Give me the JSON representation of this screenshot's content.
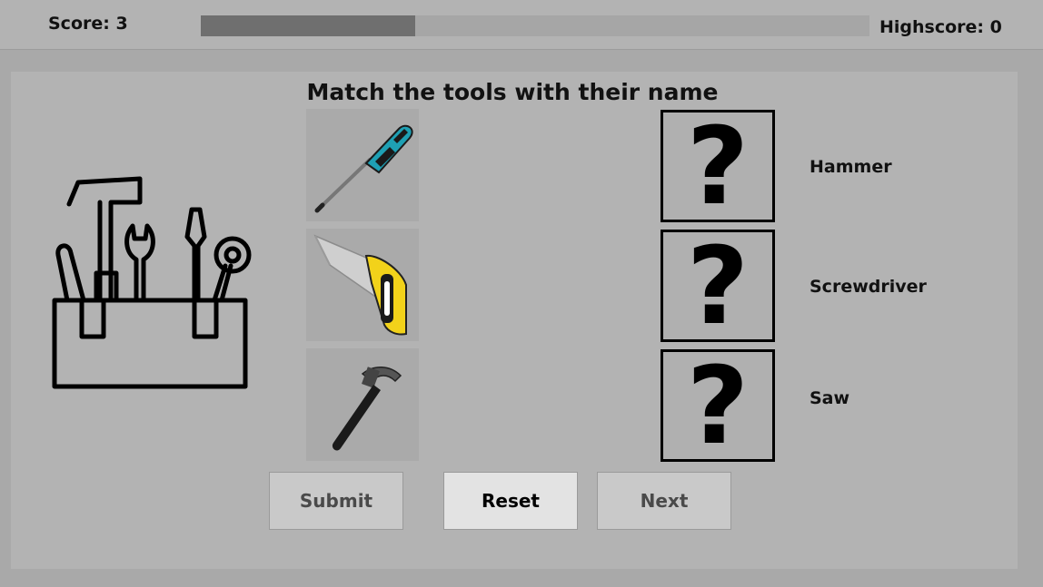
{
  "header": {
    "score_label": "Score: 3",
    "highscore_label": "Highscore: 0",
    "progress_fraction": 0.32
  },
  "game": {
    "title": "Match the tools with their name",
    "tools": [
      {
        "icon": "screwdriver-image"
      },
      {
        "icon": "saw-image"
      },
      {
        "icon": "hammer-image"
      }
    ],
    "slots": [
      "?",
      "?",
      "?"
    ],
    "names": [
      "Hammer",
      "Screwdriver",
      "Saw"
    ]
  },
  "buttons": {
    "submit": "Submit",
    "reset": "Reset",
    "next": "Next"
  },
  "colors": {
    "background": "#a9a9a9",
    "panel": "#b3b3b3",
    "progress_fill": "#6f6f6f",
    "screwdriver_accent": "#1ea0b4",
    "saw_handle": "#f2d21a"
  }
}
